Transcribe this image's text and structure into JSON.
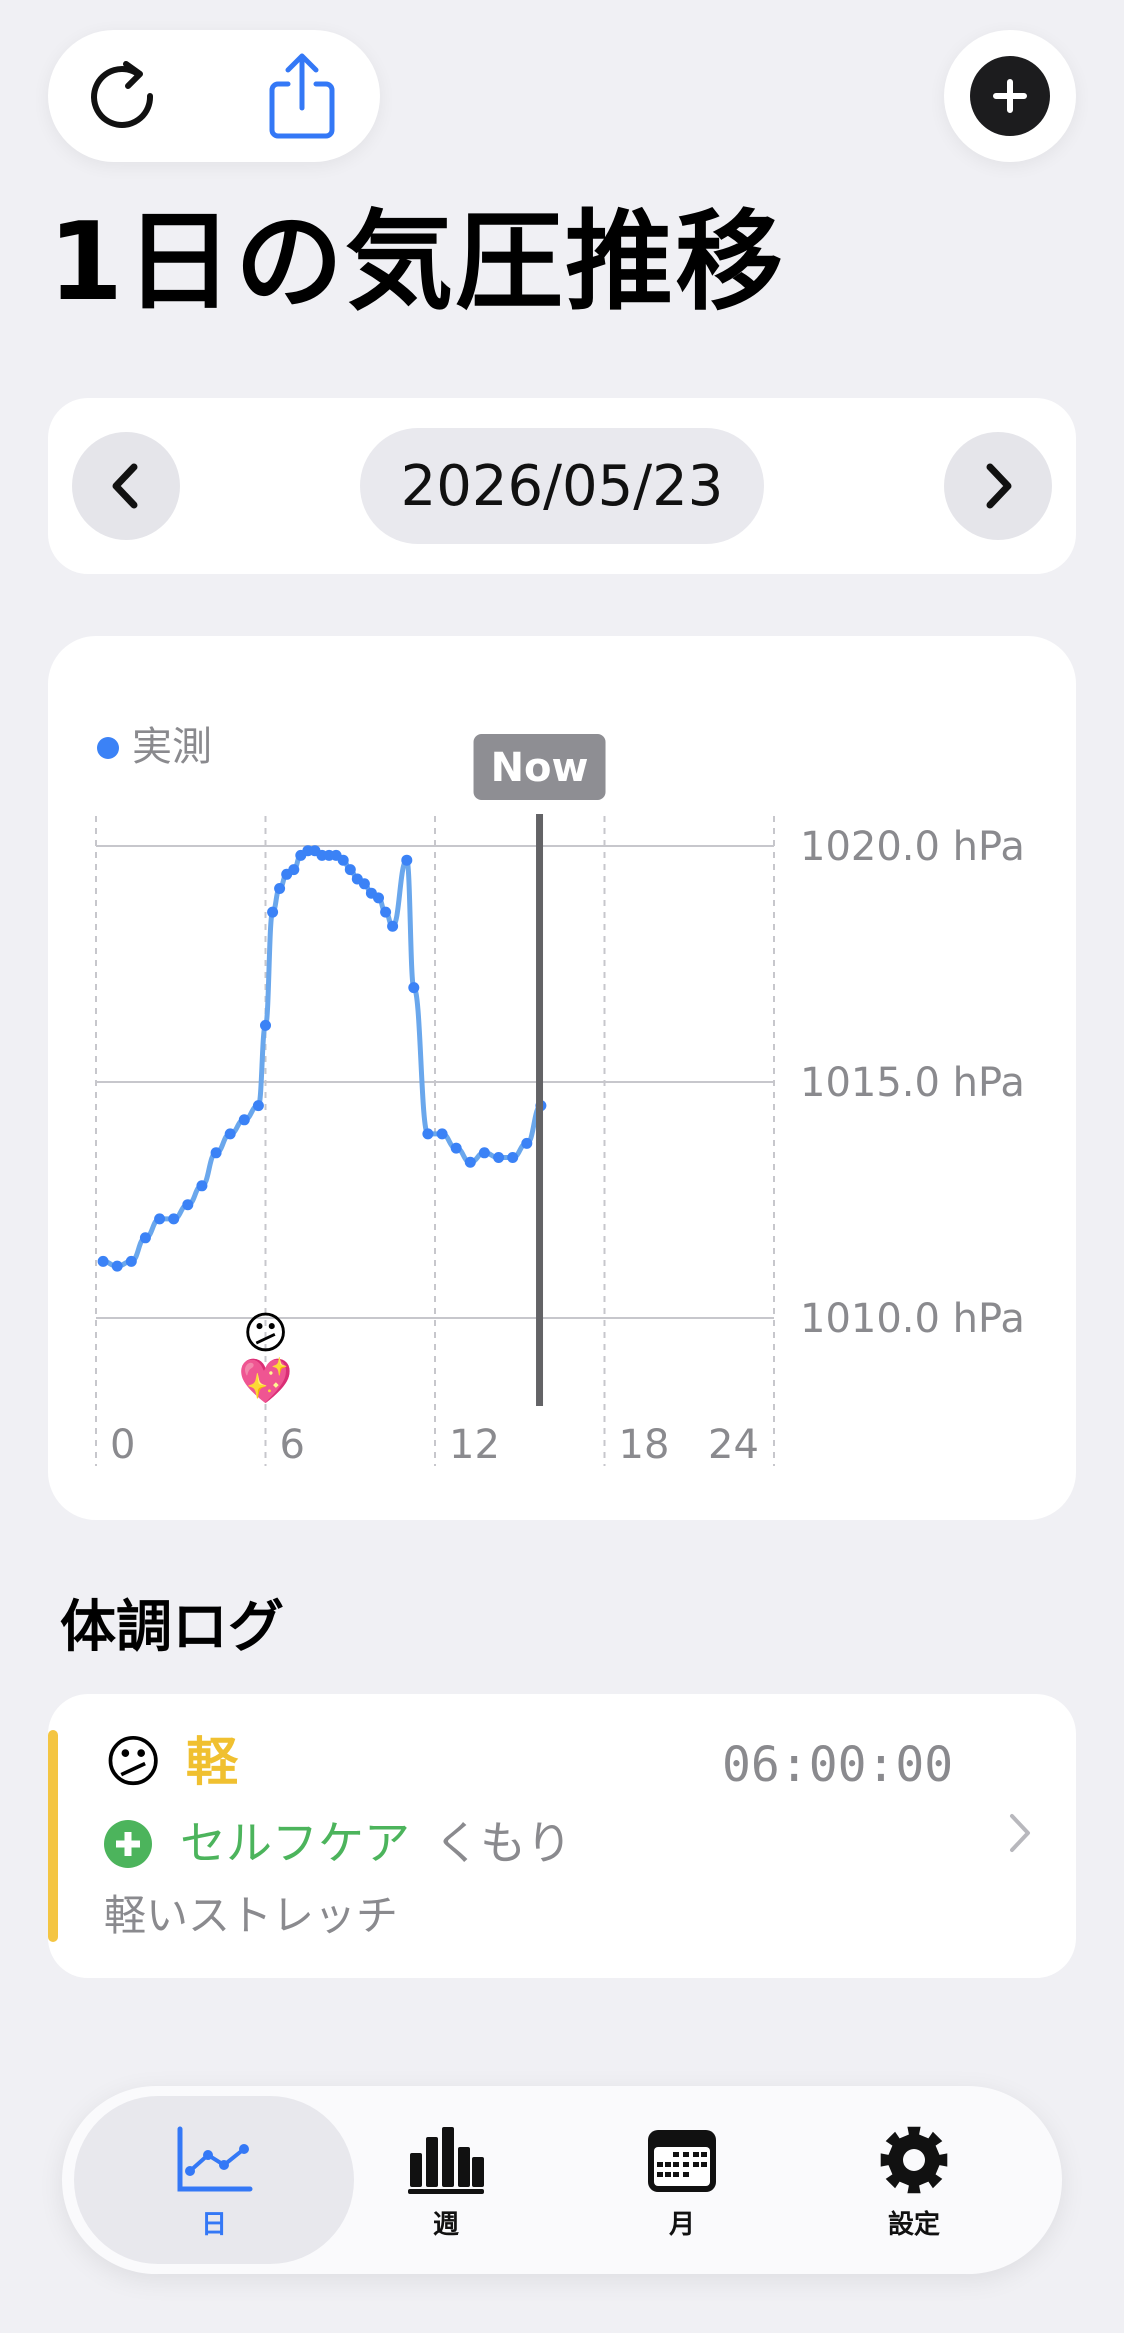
{
  "header": {
    "title": "1日の気圧推移",
    "refresh_icon": "refresh-icon",
    "share_icon": "share-icon",
    "add_icon": "plus-icon"
  },
  "date_nav": {
    "date": "2026/05/23",
    "prev_icon": "chevron-left-icon",
    "next_icon": "chevron-right-icon"
  },
  "chart_data": {
    "type": "line",
    "title": "",
    "legend": [
      {
        "label": "実測",
        "color": "#3b82f6"
      }
    ],
    "legend_position": "top-left",
    "now_label": "Now",
    "now_hour": 15.7,
    "x_ticks": [
      0,
      6,
      12,
      18,
      24
    ],
    "x_tick_labels": [
      "0",
      "6",
      "12",
      "18",
      "24"
    ],
    "xlim": [
      0,
      24
    ],
    "y_ticks": [
      1010,
      1015,
      1020
    ],
    "y_tick_labels": [
      "1010.0 hPa",
      "1015.0 hPa",
      "1020.0 hPa"
    ],
    "ylim": [
      1007.9,
      1020.8
    ],
    "grid": true,
    "series": [
      {
        "name": "実測",
        "color": "#3b82f6",
        "x": [
          0.25,
          0.75,
          1.25,
          1.75,
          2.25,
          2.75,
          3.25,
          3.75,
          4.25,
          4.75,
          5.25,
          5.75,
          6.0,
          6.25,
          6.5,
          6.75,
          7.0,
          7.25,
          7.5,
          7.75,
          8.0,
          8.25,
          8.5,
          8.75,
          9.0,
          9.25,
          9.5,
          9.75,
          10.0,
          10.25,
          10.5,
          11.0,
          11.25,
          11.75,
          12.25,
          12.75,
          13.25,
          13.75,
          14.25,
          14.75,
          15.25,
          15.75
        ],
        "values": [
          1011.2,
          1011.1,
          1011.2,
          1011.7,
          1012.1,
          1012.1,
          1012.4,
          1012.8,
          1013.5,
          1013.9,
          1014.2,
          1014.5,
          1016.2,
          1018.6,
          1019.1,
          1019.4,
          1019.5,
          1019.8,
          1019.9,
          1019.9,
          1019.8,
          1019.8,
          1019.8,
          1019.7,
          1019.5,
          1019.3,
          1019.2,
          1019.0,
          1018.9,
          1018.6,
          1018.3,
          1019.7,
          1017.0,
          1013.9,
          1013.9,
          1013.6,
          1013.3,
          1013.5,
          1013.4,
          1013.4,
          1013.7,
          1014.5
        ]
      }
    ],
    "annotations": [
      {
        "hour": 6,
        "emoji": "😕"
      },
      {
        "hour": 6,
        "emoji": "💖"
      }
    ]
  },
  "log": {
    "section_title": "体調ログ",
    "entries": [
      {
        "emoji": "😕",
        "level": "軽",
        "time": "06:00:00",
        "care": "セルフケア",
        "weather": "くもり",
        "note": "軽いストレッチ",
        "level_color": "#f4c542"
      }
    ]
  },
  "tabs": [
    {
      "label": "日",
      "icon": "line-chart-icon",
      "active": true
    },
    {
      "label": "週",
      "icon": "bar-chart-icon",
      "active": false
    },
    {
      "label": "月",
      "icon": "calendar-icon",
      "active": false
    },
    {
      "label": "設定",
      "icon": "gear-icon",
      "active": false
    }
  ],
  "colors": {
    "accent": "#3478f6",
    "series_line": "#6aa7ec",
    "series_point": "#3b82f6",
    "now_line": "#636366",
    "log_bar": "#f4c542",
    "care": "#4cb45c",
    "background": "#f0f0f4"
  }
}
